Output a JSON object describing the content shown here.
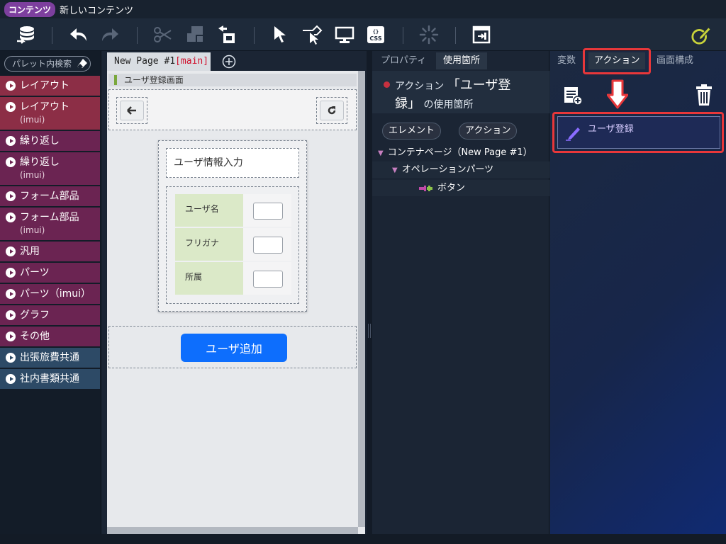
{
  "title_bar": {
    "badge": "コンテンツ",
    "title": "新しいコンテンツ"
  },
  "palette": {
    "search_placeholder": "パレット内検索",
    "items": [
      {
        "label": "レイアウト",
        "sub": "",
        "color": "red"
      },
      {
        "label": "レイアウト",
        "sub": "(imui)",
        "color": "red"
      },
      {
        "label": "繰り返し",
        "sub": "",
        "color": "mag"
      },
      {
        "label": "繰り返し",
        "sub": "(imui)",
        "color": "mag"
      },
      {
        "label": "フォーム部品",
        "sub": "",
        "color": "mag"
      },
      {
        "label": "フォーム部品",
        "sub": "(imui)",
        "color": "mag"
      },
      {
        "label": "汎用",
        "sub": "",
        "color": "mag"
      },
      {
        "label": "パーツ",
        "sub": "",
        "color": "mag"
      },
      {
        "label": "パーツ（imui）",
        "sub": "",
        "color": "mag"
      },
      {
        "label": "グラフ",
        "sub": "",
        "color": "mag"
      },
      {
        "label": "その他",
        "sub": "",
        "color": "mag"
      },
      {
        "label": "出張旅費共通",
        "sub": "",
        "color": "blue"
      },
      {
        "label": "社内書類共通",
        "sub": "",
        "color": "blue"
      }
    ]
  },
  "editor": {
    "tab_name": "New Page #1",
    "tab_mode": "[main]",
    "screen_label": "ユーザ登録画面",
    "form_title": "ユーザ情報入力",
    "fields": [
      "ユーザ名",
      "フリガナ",
      "所属"
    ],
    "add_button": "ユーザ追加"
  },
  "props": {
    "tabs": [
      "プロパティ",
      "使用箇所"
    ],
    "head_prefix": "アクション",
    "head_open": "「ユーザ登",
    "head_close": "録」",
    "head_suffix": "の使用箇所",
    "chips": [
      "エレメント",
      "アクション"
    ],
    "tree": [
      "コンテナページ（New Page #1）",
      "オペレーションパーツ",
      "ボタン"
    ]
  },
  "right": {
    "tabs": [
      "変数",
      "アクション",
      "画面構成"
    ],
    "action_item": "ユーザ登録"
  }
}
